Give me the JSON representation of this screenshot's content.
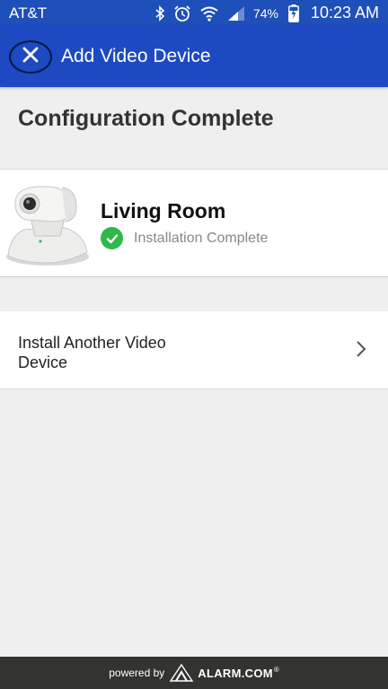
{
  "status_bar": {
    "carrier": "AT&T",
    "battery_percent": "74%",
    "time": "10:23 AM",
    "icons": [
      "bluetooth-icon",
      "alarm-clock-icon",
      "wifi-icon",
      "signal-icon",
      "battery-charging-icon"
    ]
  },
  "app_bar": {
    "title": "Add Video Device",
    "close_icon": "close-icon"
  },
  "main": {
    "section_title": "Configuration Complete",
    "device": {
      "name": "Living Room",
      "status": "Installation Complete",
      "status_icon": "check-circle-icon"
    },
    "install_another_label": "Install Another Video Device"
  },
  "footer": {
    "powered_by": "powered by",
    "brand": "ALARM.COM",
    "trademark": "®"
  },
  "colors": {
    "app_bar": "#1d4ac3",
    "status_bar": "#1f4fb8",
    "success": "#2fb84a",
    "footer": "#333431",
    "background": "#efefef"
  }
}
